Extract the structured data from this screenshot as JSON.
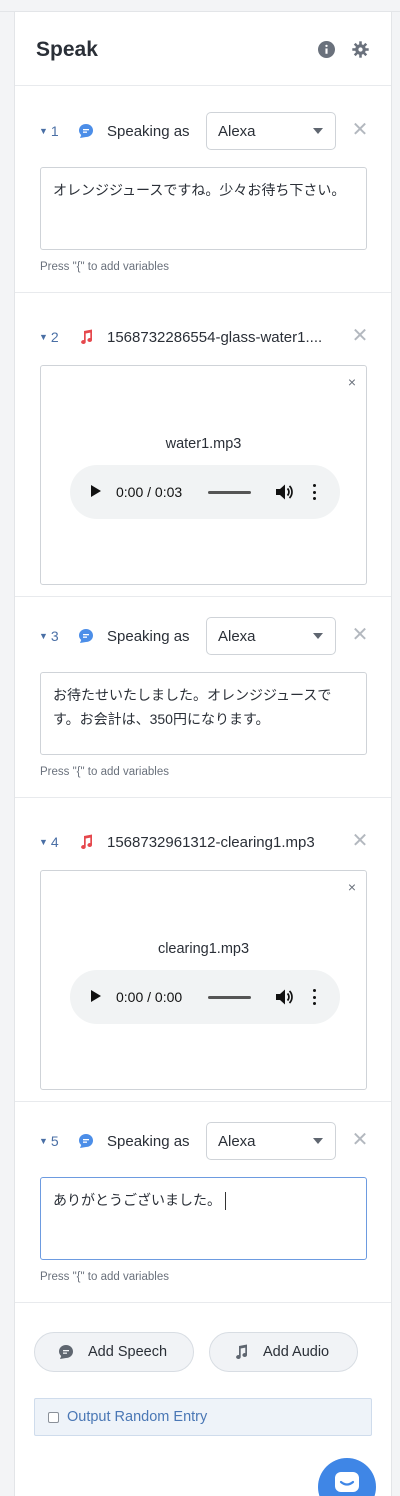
{
  "header": {
    "title": "Speak"
  },
  "items": [
    {
      "index": "1",
      "type": "speech",
      "speaking_as": "Speaking as",
      "voice": "Alexa",
      "text": "オレンジジュースですね。少々お待ち下さい。",
      "hint": "Press \"{\" to add variables"
    },
    {
      "index": "2",
      "type": "audio",
      "filename": "1568732286554-glass-water1....",
      "audio_name": "water1.mp3",
      "time": "0:00 / 0:03",
      "remove": "×"
    },
    {
      "index": "3",
      "type": "speech",
      "speaking_as": "Speaking as",
      "voice": "Alexa",
      "text": "お待たせいたしました。オレンジジュースです。お会計は、350円になります。",
      "hint": "Press \"{\" to add variables"
    },
    {
      "index": "4",
      "type": "audio",
      "filename": "1568732961312-clearing1.mp3",
      "audio_name": "clearing1.mp3",
      "time": "0:00 / 0:00",
      "remove": "×"
    },
    {
      "index": "5",
      "type": "speech",
      "speaking_as": "Speaking as",
      "voice": "Alexa",
      "text": "ありがとうございました。",
      "hint": "Press \"{\" to add variables"
    }
  ],
  "actions": {
    "add_speech": "Add Speech",
    "add_audio": "Add Audio"
  },
  "random": {
    "label": "Output Random Entry"
  },
  "colors": {
    "accent": "#3f86e6",
    "speech_icon": "#4c8ee8",
    "audio_icon": "#e5484d"
  }
}
